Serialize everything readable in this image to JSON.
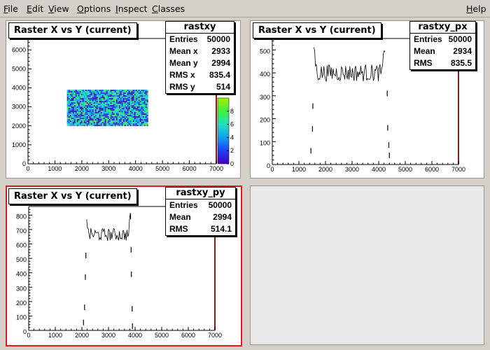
{
  "menu": {
    "file": {
      "u": "F",
      "rest": "ile"
    },
    "edit": {
      "u": "E",
      "rest": "dit"
    },
    "view": {
      "u": "V",
      "rest": "iew"
    },
    "options": {
      "u": "O",
      "rest": "ptions"
    },
    "inspect": {
      "u": "I",
      "rest": "nspect"
    },
    "classes": {
      "u": "C",
      "rest": "lasses"
    },
    "help": {
      "u": "H",
      "rest": "elp"
    }
  },
  "pads": {
    "scatter": {
      "title": "Raster X vs Y (current)",
      "stats": {
        "name": "rastxy",
        "rows": [
          {
            "label": "Entries",
            "value": "50000"
          },
          {
            "label": "Mean x",
            "value": "2933"
          },
          {
            "label": "Mean y",
            "value": "2994"
          },
          {
            "label": "RMS x",
            "value": "835.4"
          },
          {
            "label": "RMS y",
            "value": "514"
          }
        ]
      }
    },
    "px": {
      "title": "Raster X vs Y (current)",
      "stats": {
        "name": "rastxy_px",
        "rows": [
          {
            "label": "Entries",
            "value": "50000"
          },
          {
            "label": "Mean",
            "value": "2934"
          },
          {
            "label": "RMS",
            "value": "835.5"
          }
        ]
      }
    },
    "py": {
      "title": "Raster X vs Y (current)",
      "stats": {
        "name": "rastxy_py",
        "rows": [
          {
            "label": "Entries",
            "value": "50000"
          },
          {
            "label": "Mean",
            "value": "2994"
          },
          {
            "label": "RMS",
            "value": "514.1"
          }
        ]
      }
    }
  },
  "colors": {
    "frame_right": "#8b1a1a",
    "selected_border": "#d42020",
    "hist_line": "#000000"
  },
  "chart_data": [
    {
      "type": "heatmap",
      "name": "rastxy",
      "x_ticks": [
        "0",
        "1000",
        "2000",
        "3000",
        "4000",
        "5000",
        "6000",
        "7000"
      ],
      "y_ticks": [
        "0",
        "1000",
        "2000",
        "3000",
        "4000",
        "5000",
        "6000"
      ],
      "z_ticks": [
        "0",
        "2",
        "4",
        "6",
        "8"
      ],
      "xlim": [
        0,
        7000
      ],
      "ylim": [
        0,
        6600
      ],
      "zlim": [
        0,
        10
      ],
      "filled_region": {
        "x": [
          1450,
          4450
        ],
        "y": [
          2050,
          3900
        ]
      },
      "palette": [
        "#5a00c0",
        "#2a3ff0",
        "#18a8f0",
        "#20e0c8",
        "#50f050"
      ]
    },
    {
      "type": "line",
      "name": "rastxy_px",
      "x_ticks": [
        "0",
        "1000",
        "2000",
        "3000",
        "4000",
        "5000",
        "6000",
        "7000"
      ],
      "y_ticks": [
        "0",
        "100",
        "200",
        "300",
        "400",
        "500"
      ],
      "xlim": [
        0,
        7000
      ],
      "ylim": [
        0,
        550
      ],
      "plateau": {
        "x": [
          1560,
          4240
        ],
        "level": 400,
        "noise": 38,
        "edge_peak": 520
      },
      "spikes": [
        {
          "x": 1450,
          "y": 60
        },
        {
          "x": 1510,
          "y": 155
        },
        {
          "x": 1525,
          "y": 255
        },
        {
          "x": 4320,
          "y": 310
        },
        {
          "x": 4340,
          "y": 160
        },
        {
          "x": 4380,
          "y": 85
        },
        {
          "x": 4400,
          "y": 40
        }
      ]
    },
    {
      "type": "line",
      "name": "rastxy_py",
      "x_ticks": [
        "0",
        "1000",
        "2000",
        "3000",
        "4000",
        "5000",
        "6000",
        "7000"
      ],
      "y_ticks": [
        "0",
        "100",
        "200",
        "300",
        "400",
        "500",
        "600",
        "700",
        "800"
      ],
      "xlim": [
        0,
        7000
      ],
      "ylim": [
        0,
        860
      ],
      "plateau": {
        "x": [
          2180,
          3820
        ],
        "level": 665,
        "noise": 45,
        "edge_peak": 790
      },
      "spikes": [
        {
          "x": 2060,
          "y": 55
        },
        {
          "x": 2100,
          "y": 160
        },
        {
          "x": 2130,
          "y": 370
        },
        {
          "x": 2150,
          "y": 520
        },
        {
          "x": 3830,
          "y": 790
        },
        {
          "x": 3850,
          "y": 560
        },
        {
          "x": 3860,
          "y": 390
        },
        {
          "x": 3890,
          "y": 150
        },
        {
          "x": 3900,
          "y": 30
        }
      ]
    }
  ]
}
